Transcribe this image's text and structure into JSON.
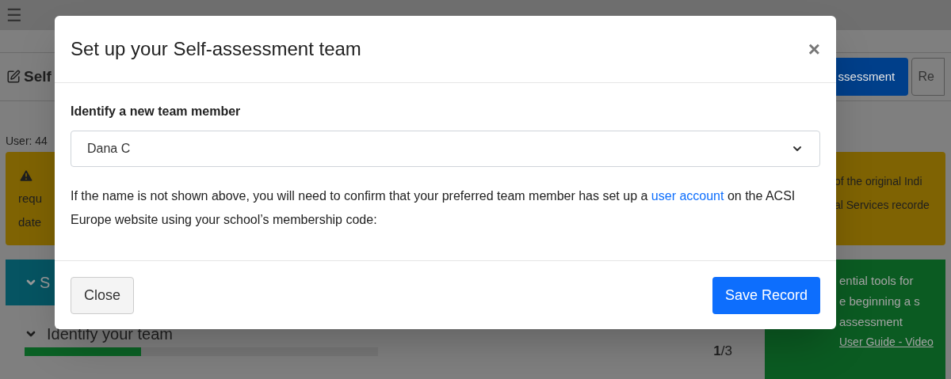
{
  "background": {
    "menu_icon": "☰",
    "page_heading": "Self",
    "header_buttons": [
      {
        "label": "ssessment",
        "selected": true
      },
      {
        "label": "Re",
        "selected": false
      }
    ],
    "user_label": "User: 44",
    "alert": {
      "left_lines": [
        "requ",
        "date"
      ],
      "right_lines": [
        "of the original Indi",
        "al Services recorde"
      ]
    },
    "section_bar": {
      "label": "S"
    },
    "step": {
      "title": "Identify your team",
      "level": 0.33,
      "count": "**1**/3"
    },
    "tools_panel": {
      "lines": [
        "ential tools for",
        "e beginning a s",
        "assessment"
      ],
      "link": "User Guide - Video"
    }
  },
  "modal": {
    "title": "Set up your Self-assessment team",
    "close": "×",
    "field_label": "Identify a new team member",
    "select_value": "Dana C",
    "help_before": "If the name is not shown above, you will need to confirm that your preferred team member has set up a ",
    "help_link": "user account",
    "help_after": " on the ACSI Europe website using your school’s membership code:",
    "buttons": [
      {
        "label": "Close",
        "kind": "secondary"
      },
      {
        "label": "Save Record",
        "kind": "primary"
      }
    ]
  }
}
